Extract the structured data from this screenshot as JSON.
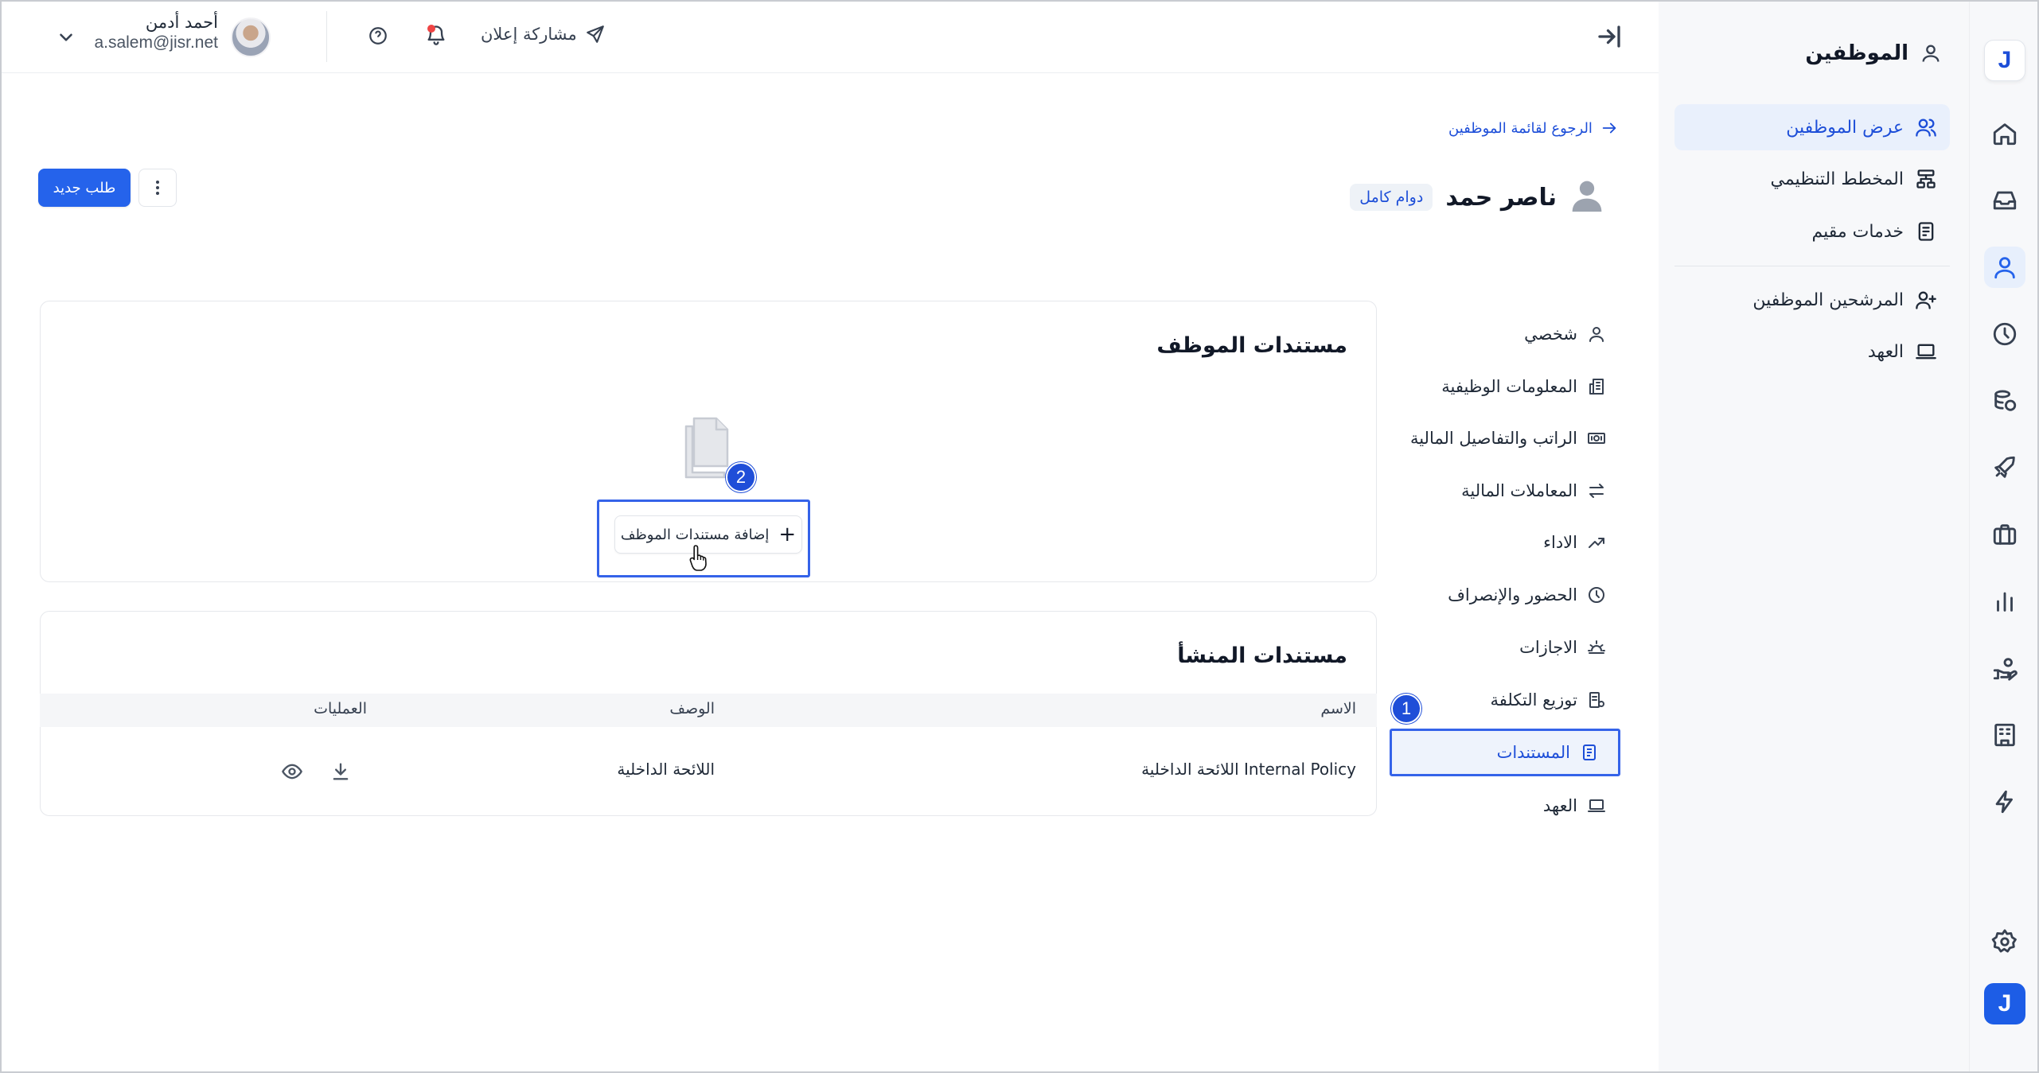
{
  "rail": {
    "items": [
      {
        "name": "home-icon"
      },
      {
        "name": "inbox-icon"
      },
      {
        "name": "user-icon",
        "active": true
      },
      {
        "name": "clock-icon"
      },
      {
        "name": "coins-icon"
      },
      {
        "name": "rocket-icon"
      },
      {
        "name": "briefcase-icon"
      },
      {
        "name": "bar-chart-icon"
      },
      {
        "name": "hand-coins-icon"
      },
      {
        "name": "building-icon"
      },
      {
        "name": "lightning-icon"
      },
      {
        "name": "gear-icon"
      }
    ],
    "logo_letter": "J"
  },
  "sidebar": {
    "title": "الموظفين",
    "items": [
      {
        "label": "عرض الموظفين",
        "active": true
      },
      {
        "label": "المخطط التنظيمي"
      },
      {
        "label": "خدمات مقيم"
      },
      {
        "label": "المرشحين الموظفين"
      },
      {
        "label": "العهد"
      }
    ]
  },
  "header": {
    "share_label": "مشاركة إعلان",
    "user_name": "أحمد أدمن",
    "user_email": "a.salem@jisr.net"
  },
  "employee": {
    "back_label": "الرجوع لقائمة الموظفين",
    "name": "ناصر حمد",
    "badge": "دوام كامل",
    "new_request_label": "طلب جديد"
  },
  "profile_nav": [
    {
      "label": "شخصي",
      "icon": "user-icon"
    },
    {
      "label": "المعلومات الوظيفية",
      "icon": "building-icon"
    },
    {
      "label": "الراتب والتفاصيل المالية",
      "icon": "money-icon"
    },
    {
      "label": "المعاملات المالية",
      "icon": "swap-icon"
    },
    {
      "label": "الاداء",
      "icon": "trend-icon"
    },
    {
      "label": "الحضور والإنصراف",
      "icon": "clock-icon"
    },
    {
      "label": "الاجازات",
      "icon": "sun-icon"
    },
    {
      "label": "توزيع التكلفة",
      "icon": "cost-icon"
    },
    {
      "label": "المستندات",
      "icon": "document-icon",
      "active": true
    },
    {
      "label": "العهد",
      "icon": "laptop-icon"
    }
  ],
  "employee_docs": {
    "title": "مستندات الموظف",
    "add_label": "إضافة مستندات الموظف"
  },
  "company_docs": {
    "title": "مستندات المنشأ",
    "columns": [
      "الاسم",
      "الوصف",
      "العمليات"
    ],
    "rows": [
      {
        "name": "Internal Policy اللائحة الداخلية",
        "description": "اللائحة الداخلية"
      }
    ]
  },
  "annotations": {
    "step1": "1",
    "step2": "2"
  },
  "colors": {
    "accent": "#2563eb",
    "highlight_border": "#3563e9",
    "notification_dot": "#ef4444"
  }
}
